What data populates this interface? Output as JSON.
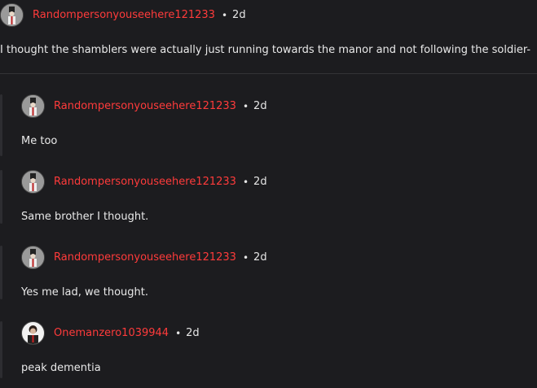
{
  "comments": [
    {
      "username": "Randompersonyouseehere121233",
      "separator": "•",
      "time": "2d",
      "body": "I thought the shamblers were actually just running towards the manor and not following the soldier-"
    },
    {
      "username": "Randompersonyouseehere121233",
      "separator": "•",
      "time": "2d",
      "body": "Me too"
    },
    {
      "username": "Randompersonyouseehere121233",
      "separator": "•",
      "time": "2d",
      "body": "Same brother I thought."
    },
    {
      "username": "Randompersonyouseehere121233",
      "separator": "•",
      "time": "2d",
      "body": "Yes me lad, we thought."
    },
    {
      "username": "Onemanzero1039944",
      "separator": "•",
      "time": "2d",
      "body": "peak dementia"
    }
  ],
  "colors": {
    "background": "#1c1c1f",
    "username": "#ff3b3b",
    "text": "#e6e6e6",
    "divider": "#333336"
  }
}
